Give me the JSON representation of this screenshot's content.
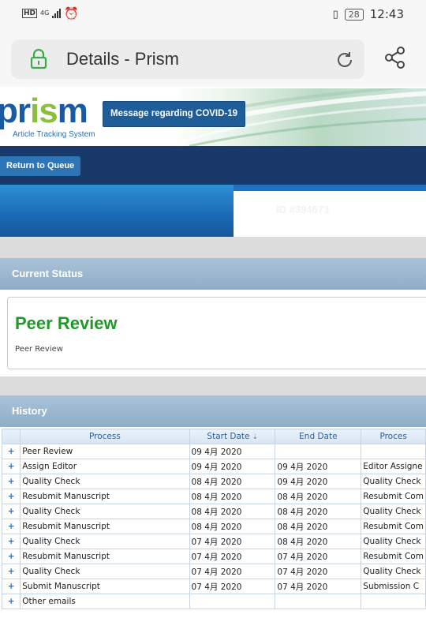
{
  "status_bar": {
    "hd": "HD",
    "network": "4G",
    "battery": "28",
    "time": "12:43"
  },
  "browser": {
    "page_title": "Details - Prism"
  },
  "header": {
    "logo": "prism",
    "logo_subtitle": "Article Tracking System",
    "covid_button": "Message regarding COVID-19"
  },
  "nav": {
    "return_button": "Return to Queue"
  },
  "manuscript": {
    "id_label": "ID #394673"
  },
  "current_status": {
    "heading": "Current Status",
    "status_title": "Peer Review",
    "status_detail": "Peer Review"
  },
  "history": {
    "heading": "History",
    "columns": [
      "Process",
      "Start Date",
      "End Date",
      "Proces"
    ],
    "sort_indicator": "⇣",
    "rows": [
      {
        "process": "Peer Review",
        "start": "09 4月 2020",
        "end": "",
        "proc2": ""
      },
      {
        "process": "Assign Editor",
        "start": "09 4月 2020",
        "end": "09 4月 2020",
        "proc2": "Editor Assigne"
      },
      {
        "process": "Quality Check",
        "start": "08 4月 2020",
        "end": "09 4月 2020",
        "proc2": "Quality Check"
      },
      {
        "process": "Resubmit Manuscript",
        "start": "08 4月 2020",
        "end": "08 4月 2020",
        "proc2": "Resubmit Com"
      },
      {
        "process": "Quality Check",
        "start": "08 4月 2020",
        "end": "08 4月 2020",
        "proc2": "Quality Check"
      },
      {
        "process": "Resubmit Manuscript",
        "start": "08 4月 2020",
        "end": "08 4月 2020",
        "proc2": "Resubmit Com"
      },
      {
        "process": "Quality Check",
        "start": "07 4月 2020",
        "end": "08 4月 2020",
        "proc2": "Quality Check"
      },
      {
        "process": "Resubmit Manuscript",
        "start": "07 4月 2020",
        "end": "07 4月 2020",
        "proc2": "Resubmit Com"
      },
      {
        "process": "Quality Check",
        "start": "07 4月 2020",
        "end": "07 4月 2020",
        "proc2": "Quality Check"
      },
      {
        "process": "Submit Manuscript",
        "start": "07 4月 2020",
        "end": "07 4月 2020",
        "proc2": "Submission C"
      },
      {
        "process": "Other emails",
        "start": "",
        "end": "",
        "proc2": ""
      }
    ],
    "expand_symbol": "+"
  }
}
